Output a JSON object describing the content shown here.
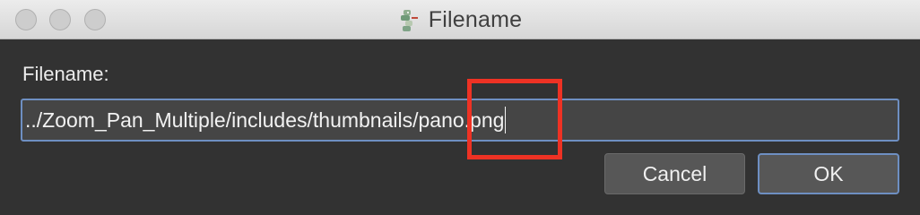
{
  "window": {
    "title": "Filename",
    "icon": "python-app-icon"
  },
  "dialog": {
    "label": "Filename:",
    "input_value": "../Zoom_Pan_Multiple/includes/thumbnails/pano.png",
    "cancel_label": "Cancel",
    "ok_label": "OK"
  },
  "annotation": {
    "highlight_color": "#ee3224"
  },
  "colors": {
    "focus_accent": "#6e8fc2",
    "dialog_background": "#323232"
  }
}
